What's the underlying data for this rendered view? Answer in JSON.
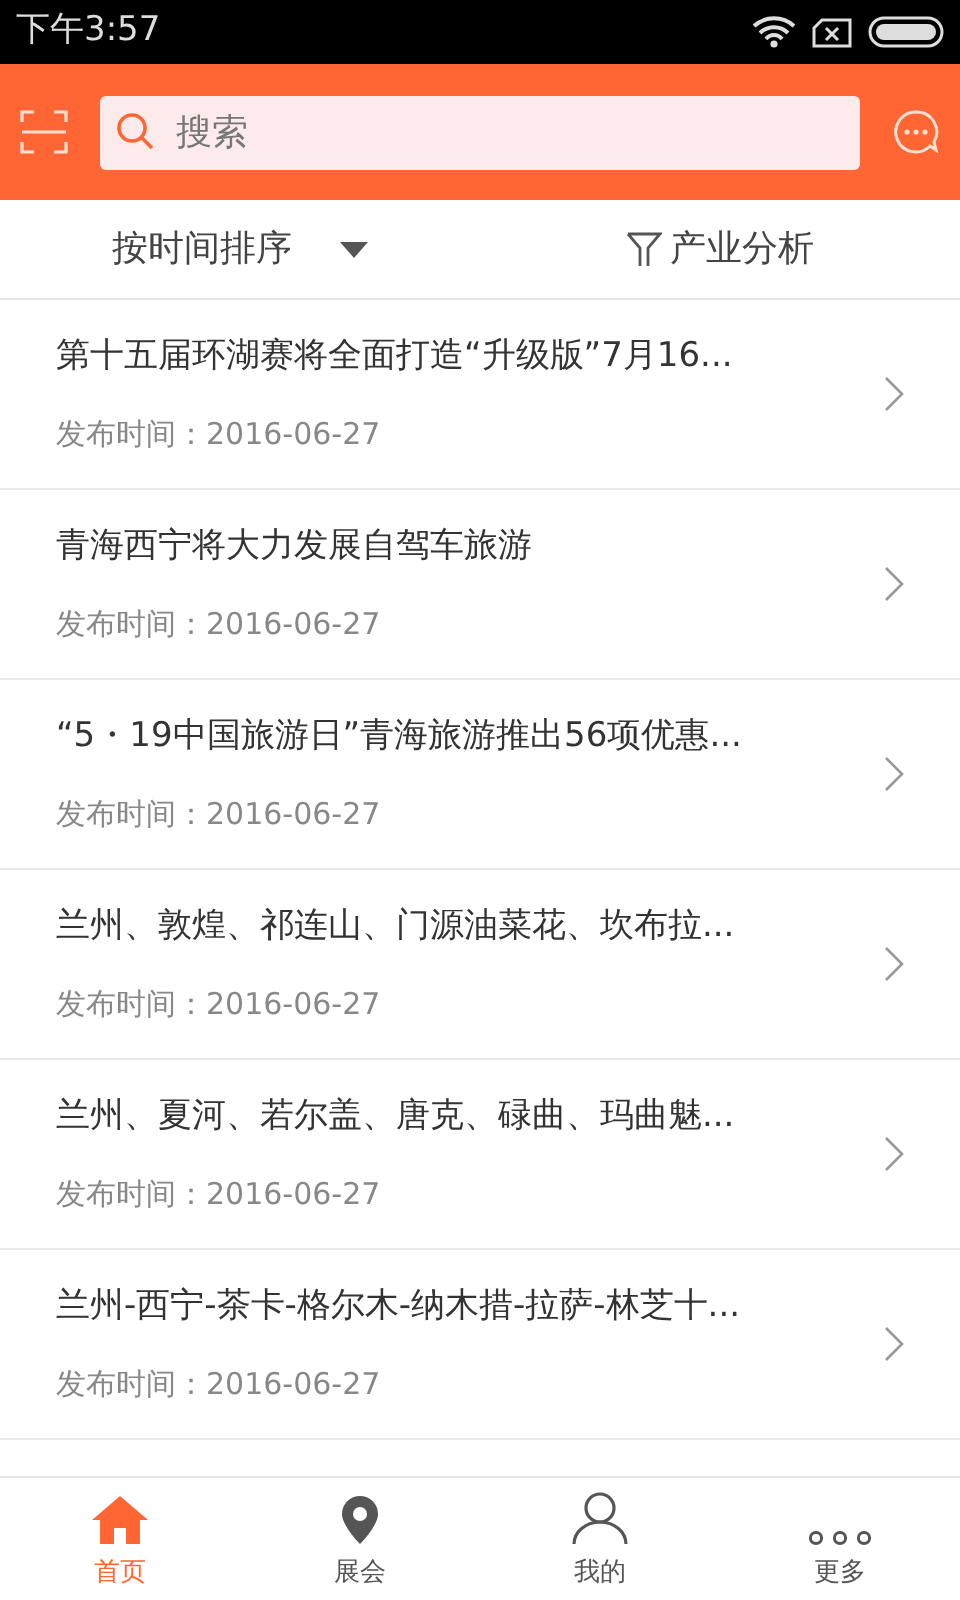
{
  "status_bar": {
    "time": "下午3:57"
  },
  "search": {
    "placeholder": "搜索"
  },
  "sort_bar": {
    "sort_label": "按时间排序",
    "filter_label": "产业分析"
  },
  "articles": [
    {
      "title": "第十五届环湖赛将全面打造“升级版”7月16...",
      "date": "发布时间：2016-06-27"
    },
    {
      "title": "青海西宁将大力发展自驾车旅游",
      "date": "发布时间：2016-06-27"
    },
    {
      "title": "“5・19中国旅游日”青海旅游推出56项优惠...",
      "date": "发布时间：2016-06-27"
    },
    {
      "title": "兰州、敦煌、祁连山、门源油菜花、坎布拉...",
      "date": "发布时间：2016-06-27"
    },
    {
      "title": "兰州、夏河、若尔盖、唐克、碌曲、玛曲魅...",
      "date": "发布时间：2016-06-27"
    },
    {
      "title": "兰州-西宁-茶卡-格尔木-纳木措-拉萨-林芝十...",
      "date": "发布时间：2016-06-27"
    }
  ],
  "tab_bar": [
    {
      "kind": "home",
      "label": "首页",
      "selected": true
    },
    {
      "kind": "pin",
      "label": "展会",
      "selected": false
    },
    {
      "kind": "person",
      "label": "我的",
      "selected": false
    },
    {
      "kind": "dots",
      "label": "更多",
      "selected": false
    }
  ]
}
